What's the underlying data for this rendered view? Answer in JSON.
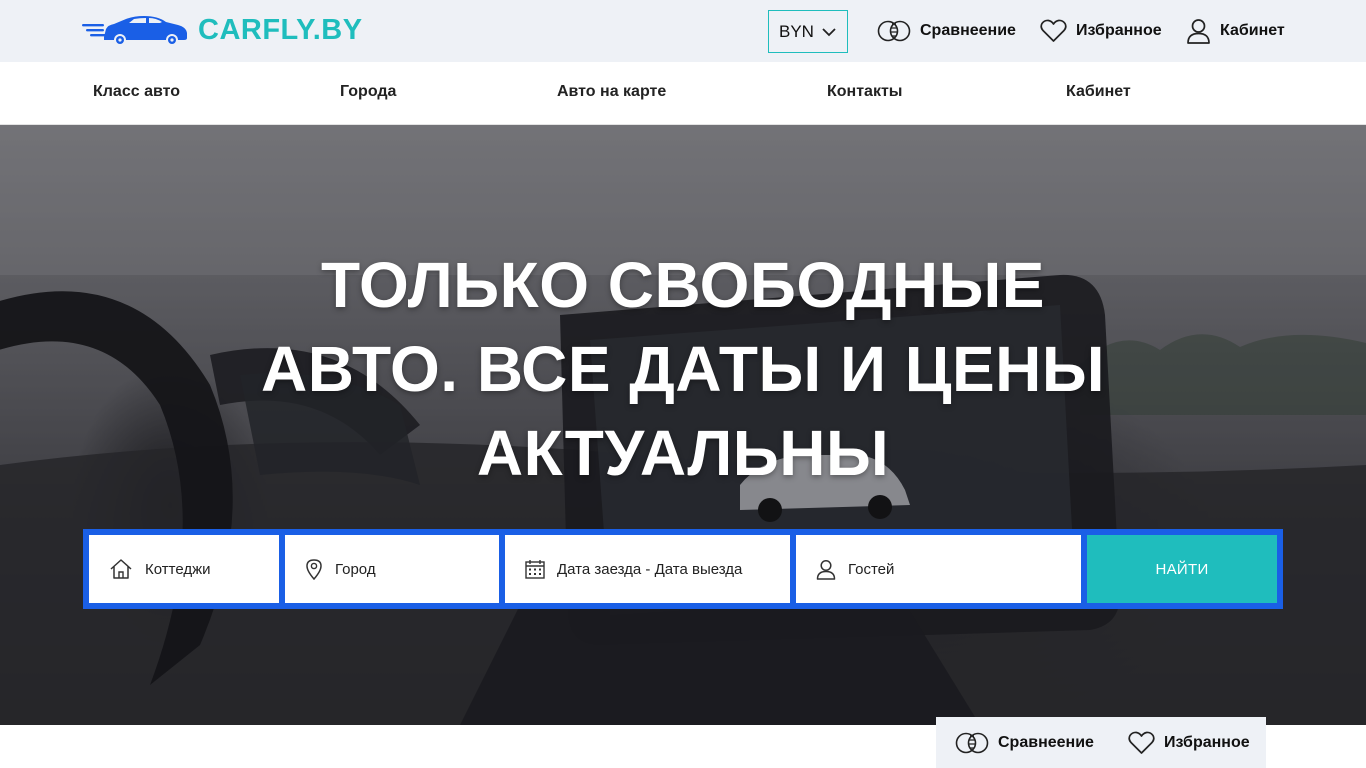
{
  "brand": {
    "name": "CARFLY.BY",
    "accent": "#1fbdbd",
    "logo_icon": "car-icon",
    "logo_color": "#1a5fe6"
  },
  "header": {
    "currency": {
      "selected": "BYN",
      "icon": "chevron-down-icon"
    },
    "compare": {
      "label": "Сравнеение",
      "icon": "compare-icon"
    },
    "favorites": {
      "label": "Избранное",
      "icon": "heart-icon"
    },
    "account": {
      "label": "Кабинет",
      "icon": "user-icon"
    }
  },
  "nav": {
    "items": [
      {
        "label": "Класс авто"
      },
      {
        "label": "Города"
      },
      {
        "label": "Авто на карте"
      },
      {
        "label": "Контакты"
      },
      {
        "label": "Кабинет"
      }
    ]
  },
  "hero": {
    "title_line1": "ТОЛЬКО СВОБОДНЫЕ",
    "title_line2": "АВТО. ВСЕ ДАТЫ И ЦЕНЫ",
    "title_line3": "АКТУАЛЬНЫ"
  },
  "search": {
    "type": {
      "value": "Коттеджи",
      "icon": "house-icon"
    },
    "city": {
      "value": "Город",
      "icon": "location-pin-icon"
    },
    "dates": {
      "value": "Дата заезда - Дата выезда",
      "icon": "calendar-icon"
    },
    "guests": {
      "value": "Гостей",
      "icon": "user-icon"
    },
    "submit_label": "НАЙТИ",
    "frame_color": "#1a5fe6",
    "button_color": "#1fbdbd"
  },
  "floating_bar": {
    "compare": {
      "label": "Сравнеение",
      "icon": "compare-icon"
    },
    "favorites": {
      "label": "Избранное",
      "icon": "heart-icon"
    }
  }
}
